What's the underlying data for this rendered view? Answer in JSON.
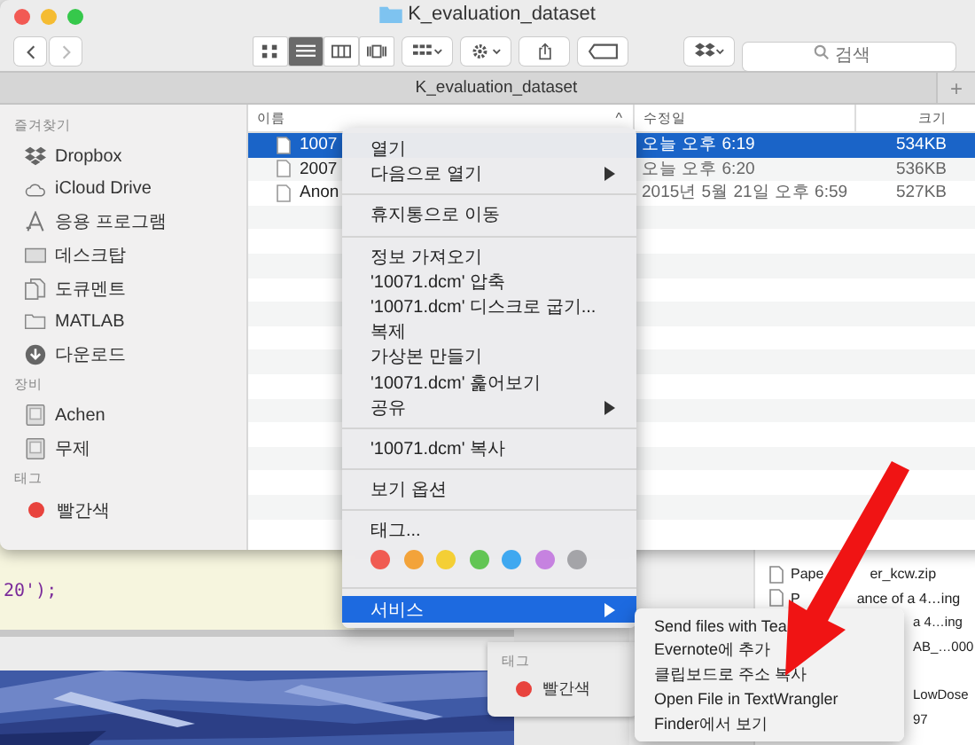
{
  "window": {
    "title": "K_evaluation_dataset"
  },
  "toolbar": {
    "views": [
      {
        "kind": "icons",
        "selected": false
      },
      {
        "kind": "list",
        "selected": true
      },
      {
        "kind": "columns",
        "selected": false
      },
      {
        "kind": "coverflow",
        "selected": false
      }
    ]
  },
  "search": {
    "placeholder": "검색"
  },
  "path_bar": {
    "title": "K_evaluation_dataset",
    "new_tab": "+"
  },
  "sidebar": {
    "sections": [
      {
        "title": "즐겨찾기",
        "items": [
          {
            "label": "Dropbox",
            "kind": "dropbox"
          },
          {
            "label": "iCloud Drive",
            "kind": "cloud"
          },
          {
            "label": "응용 프로그램",
            "kind": "apps"
          },
          {
            "label": "데스크탑",
            "kind": "desktop"
          },
          {
            "label": "도큐멘트",
            "kind": "document"
          },
          {
            "label": "MATLAB",
            "kind": "folder"
          },
          {
            "label": "다운로드",
            "kind": "download"
          }
        ]
      },
      {
        "title": "장비",
        "items": [
          {
            "label": "Achen",
            "kind": "disk"
          },
          {
            "label": "무제",
            "kind": "disk"
          }
        ]
      },
      {
        "title": "태그",
        "items": [
          {
            "label": "빨간색",
            "kind": "tag",
            "color": "#e8433d"
          }
        ]
      }
    ]
  },
  "table": {
    "columns": [
      "이름",
      "수정일",
      "크기"
    ],
    "sort_caret": "^",
    "rows": [
      {
        "name": "1007",
        "modified": "오늘 오후 6:19",
        "size": "534KB",
        "selected": true
      },
      {
        "name": "2007",
        "modified": "오늘 오후 6:20",
        "size": "536KB",
        "selected": false
      },
      {
        "name": "Anon",
        "modified": "2015년 5월 21일 오후 6:59",
        "size": "527KB",
        "selected": false
      }
    ]
  },
  "editor": {
    "code": "20');"
  },
  "context_menu": {
    "items": [
      {
        "kind": "item",
        "label": "열기",
        "submenu": false,
        "highlighted": false
      },
      {
        "kind": "item",
        "label": "다음으로 열기",
        "submenu": true,
        "highlighted": false
      },
      {
        "kind": "separator"
      },
      {
        "kind": "item",
        "label": "휴지통으로 이동",
        "submenu": false,
        "highlighted": false
      },
      {
        "kind": "separator"
      },
      {
        "kind": "item",
        "label": "정보 가져오기",
        "submenu": false,
        "highlighted": false
      },
      {
        "kind": "item",
        "label": "'10071.dcm' 압축",
        "submenu": false,
        "highlighted": false
      },
      {
        "kind": "item",
        "label": "'10071.dcm' 디스크로 굽기...",
        "submenu": false,
        "highlighted": false
      },
      {
        "kind": "item",
        "label": "복제",
        "submenu": false,
        "highlighted": false
      },
      {
        "kind": "item",
        "label": "가상본 만들기",
        "submenu": false,
        "highlighted": false
      },
      {
        "kind": "item",
        "label": "'10071.dcm' 훑어보기",
        "submenu": false,
        "highlighted": false
      },
      {
        "kind": "item",
        "label": "공유",
        "submenu": true,
        "highlighted": false
      },
      {
        "kind": "separator"
      },
      {
        "kind": "item",
        "label": "'10071.dcm' 복사",
        "submenu": false,
        "highlighted": false
      },
      {
        "kind": "separator"
      },
      {
        "kind": "item",
        "label": "보기 옵션",
        "submenu": false,
        "highlighted": false
      },
      {
        "kind": "separator"
      },
      {
        "kind": "item",
        "label": "태그...",
        "submenu": false,
        "highlighted": false
      },
      {
        "kind": "colors",
        "colors": [
          {
            "color": "#f05b52"
          },
          {
            "color": "#f3a33a"
          },
          {
            "color": "#f4cf35"
          },
          {
            "color": "#62c554"
          },
          {
            "color": "#3fa8f0"
          },
          {
            "color": "#c682e0"
          },
          {
            "color": "#a4a4a8"
          }
        ]
      },
      {
        "kind": "separator"
      },
      {
        "kind": "item",
        "label": "서비스",
        "submenu": true,
        "highlighted": true
      }
    ]
  },
  "services_menu": {
    "items": [
      "Send files with Tea",
      "Evernote에 추가",
      "클립보드로 주소 복사",
      "Open File in TextWrangler",
      "Finder에서 보기"
    ]
  },
  "tag_panel": {
    "title": "태그",
    "items": [
      {
        "label": "빨간색",
        "color": "#e8433d"
      }
    ]
  },
  "background_window": {
    "rows": [
      {
        "kind": "full",
        "parts": [
          "Pape",
          "er_kcw.zip"
        ]
      },
      {
        "kind": "full",
        "parts": [
          "P",
          "ance of a 4…ing"
        ]
      },
      {
        "kind": "clipped",
        "parts": [
          "a 4…ing"
        ]
      },
      {
        "kind": "clipped",
        "parts": [
          "AB_…000"
        ]
      },
      {
        "kind": "gap",
        "parts": []
      },
      {
        "kind": "clipped",
        "parts": [
          "LowDose"
        ]
      },
      {
        "kind": "clipped",
        "parts": [
          "97"
        ]
      }
    ]
  }
}
